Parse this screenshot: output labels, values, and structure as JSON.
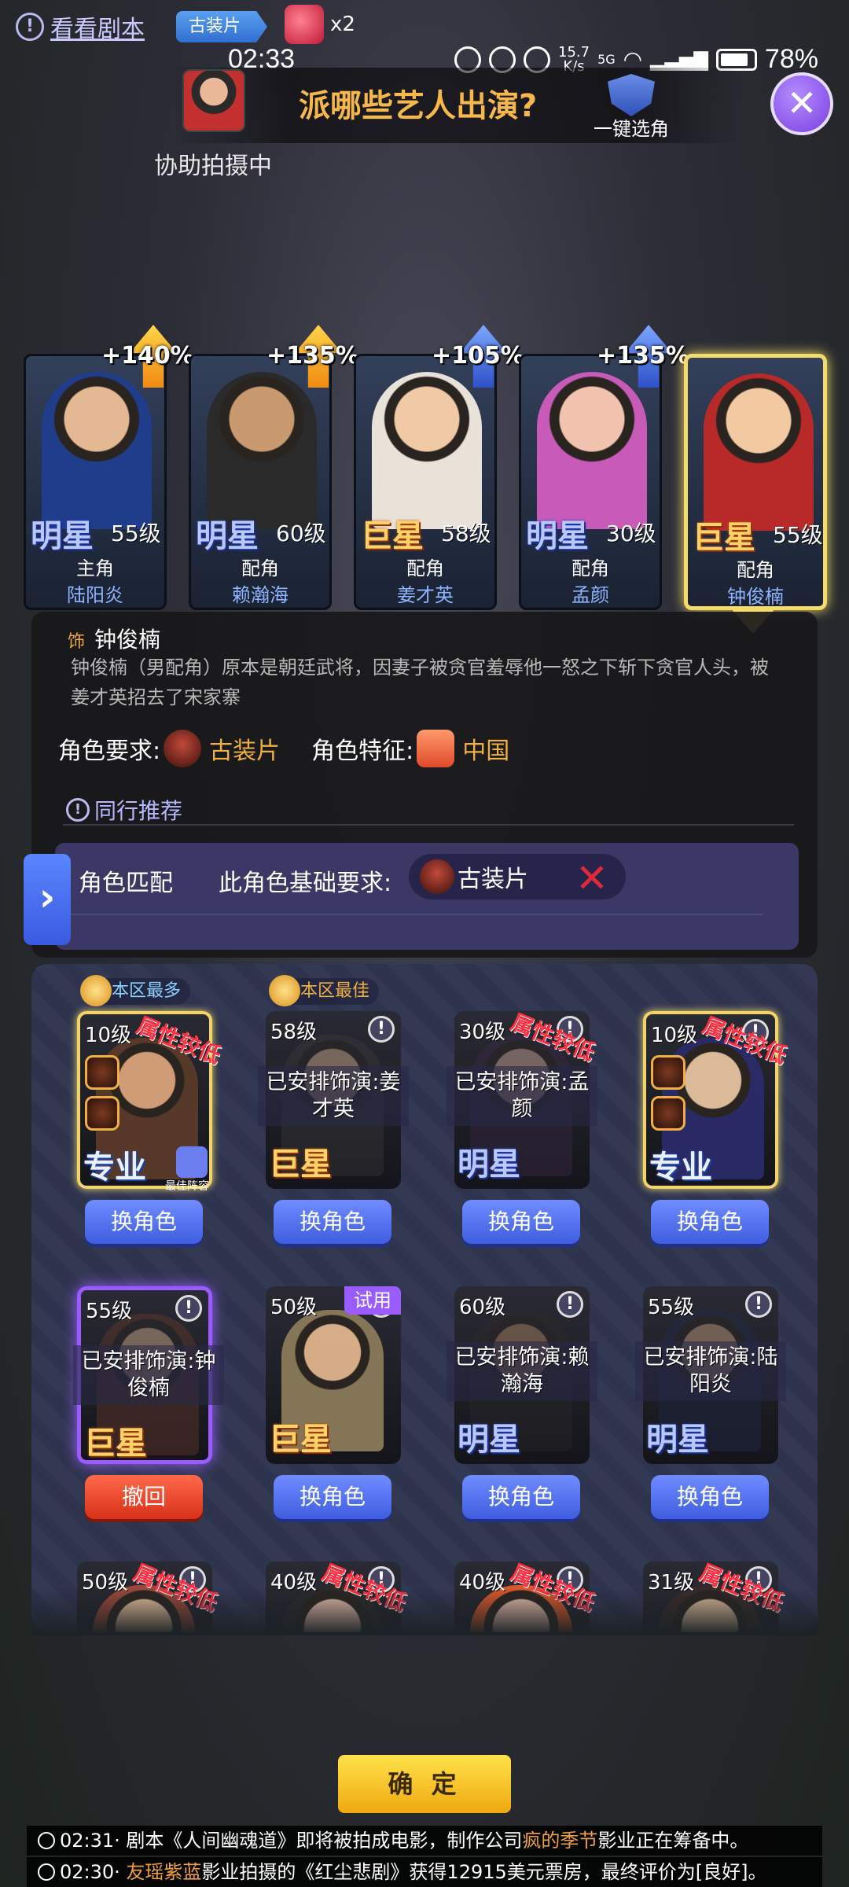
{
  "top": {
    "script_link": "看看剧本",
    "genre": "古装片",
    "ticket_count": "x2"
  },
  "status": {
    "time": "02:33",
    "net_speed_top": "15.7",
    "net_speed_unit": "K/s",
    "signal": "5G",
    "battery": "78%"
  },
  "header": {
    "title": "派哪些艺人出演?",
    "assist": "协助拍摄中",
    "auto_pick": "一键选角",
    "close": "✕"
  },
  "cast": [
    {
      "bonus": "+140%",
      "arrow": "gold",
      "rank": "明星",
      "rank_type": "mx",
      "level": "55级",
      "role": "主角",
      "name": "陆阳炎",
      "colors": [
        "#e5b894",
        "#1f3d8a"
      ]
    },
    {
      "bonus": "+135%",
      "arrow": "gold",
      "rank": "明星",
      "rank_type": "mx",
      "level": "60级",
      "role": "配角",
      "name": "赖瀚海",
      "colors": [
        "#c99a70",
        "#2a2a2a"
      ]
    },
    {
      "bonus": "+105%",
      "arrow": "blue",
      "rank": "巨星",
      "rank_type": "jx",
      "level": "58级",
      "role": "配角",
      "name": "姜才英",
      "colors": [
        "#f0c9a6",
        "#e8e2d8"
      ]
    },
    {
      "bonus": "+135%",
      "arrow": "blue",
      "rank": "明星",
      "rank_type": "mx",
      "level": "30级",
      "role": "配角",
      "name": "孟颜",
      "colors": [
        "#f2c4b0",
        "#c85ab8"
      ]
    },
    {
      "bonus": "",
      "arrow": "",
      "rank": "巨星",
      "rank_type": "jx",
      "level": "55级",
      "role": "配角",
      "name": "钟俊楠",
      "colors": [
        "#f2c9a0",
        "#b82a2a"
      ]
    }
  ],
  "info": {
    "tag": "饰",
    "title": "钟俊楠",
    "description": "钟俊楠（男配角）原本是朝廷武将，因妻子被贪官羞辱他一怒之下斩下贪官人头，被姜才英招去了宋家寨",
    "req_label": "角色要求:",
    "req_value": "古装片",
    "trait_label": "角色特征:",
    "trait_value": "中国",
    "recommend": "同行推荐"
  },
  "match": {
    "tab": "›",
    "label": "角色匹配",
    "req_label": "此角色基础要求:",
    "req_value": "古装片",
    "status": "✕"
  },
  "actors": [
    {
      "level": "10级",
      "badge": "本区最多",
      "weak": "属性较低",
      "rank": "专业",
      "rank_type": "zy",
      "frame": "gold",
      "skills": 2,
      "best_team": "最佳阵容",
      "button": "换角色",
      "colors": [
        "#d9a27a",
        "#5a3a2a"
      ]
    },
    {
      "level": "58级",
      "badge": "本区最佳",
      "info": "!",
      "assigned": "已安排饰演:姜才英",
      "rank": "巨星",
      "rank_type": "jx",
      "button": "换角色",
      "colors": [
        "#f0c9a6",
        "#3a3a3a"
      ]
    },
    {
      "level": "30级",
      "weak": "属性较低",
      "info": "!",
      "assigned": "已安排饰演:孟颜",
      "rank": "明星",
      "rank_type": "mx",
      "button": "换角色",
      "colors": [
        "#f2c4b0",
        "#3a2a4a"
      ]
    },
    {
      "level": "10级",
      "weak": "属性较低",
      "rank": "专业",
      "rank_type": "zy",
      "frame": "gold",
      "skills": 2,
      "info": "!",
      "button": "换角色",
      "colors": [
        "#e5c2a0",
        "#2a2a6a"
      ]
    },
    {
      "level": "55级",
      "info": "!",
      "assigned": "已安排饰演:钟俊楠",
      "rank": "巨星",
      "rank_type": "jx",
      "frame": "purple",
      "button": "撤回",
      "button_type": "red",
      "colors": [
        "#f2c9a0",
        "#6a3a2a"
      ]
    },
    {
      "level": "50级",
      "trial": "试用",
      "rank": "巨星",
      "rank_type": "jx",
      "info": "!",
      "button": "换角色",
      "colors": [
        "#e0b48c",
        "#8a7a5a"
      ]
    },
    {
      "level": "60级",
      "info": "!",
      "assigned": "已安排饰演:赖瀚海",
      "rank": "明星",
      "rank_type": "mx",
      "button": "换角色",
      "colors": [
        "#c99a70",
        "#2a2a2a"
      ]
    },
    {
      "level": "55级",
      "info": "!",
      "assigned": "已安排饰演:陆阳炎",
      "rank": "明星",
      "rank_type": "mx",
      "button": "换角色",
      "colors": [
        "#e5b894",
        "#1f2a4a"
      ]
    },
    {
      "level": "50级",
      "weak": "属性较低",
      "info": "!",
      "colors": [
        "#f2c9a0",
        "#a04a3a"
      ]
    },
    {
      "level": "40级",
      "weak": "属性较低",
      "info": "!",
      "colors": [
        "#f2c4b0",
        "#2a2a2a"
      ]
    },
    {
      "level": "40级",
      "weak": "属性较低",
      "info": "!",
      "colors": [
        "#f2c4b0",
        "#e05a2a"
      ]
    },
    {
      "level": "31级",
      "weak": "属性较低",
      "info": "!",
      "colors": [
        "#e5c2a0",
        "#3a2a2a"
      ]
    }
  ],
  "confirm": "确 定",
  "ticker": [
    {
      "time": "02:31",
      "pre": "· 剧本《人间幽魂道》即将被拍成电影，制作公司",
      "hl": "疯的季节",
      "post": "影业正在筹备中。"
    },
    {
      "time": "02:30",
      "pre": "· ",
      "hl": "友瑶紫蓝",
      "post": "影业拍摄的《红尘悲剧》获得12915美元票房，最终评价为[良好]。"
    }
  ]
}
